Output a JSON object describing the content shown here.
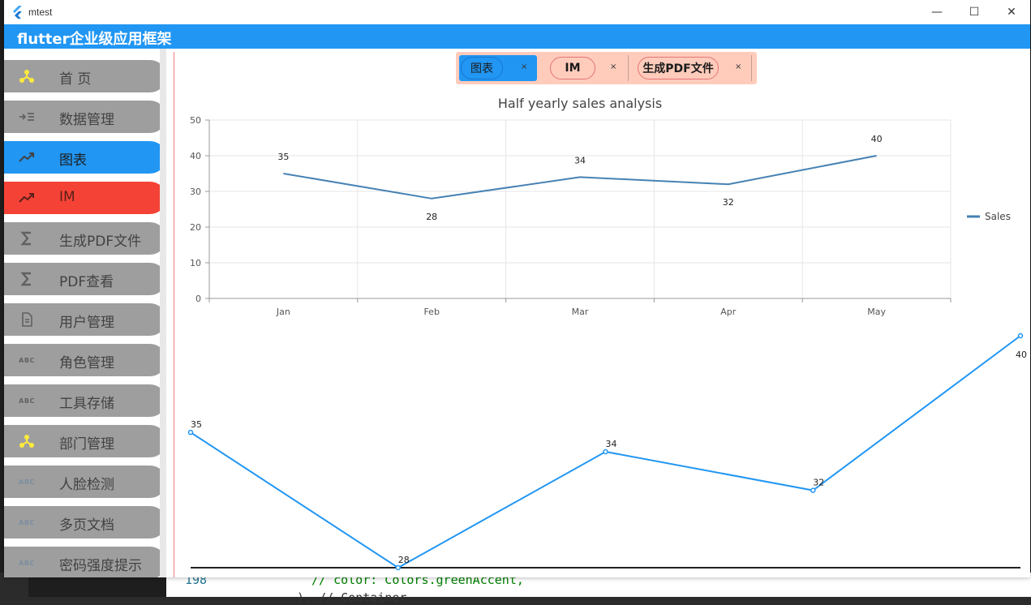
{
  "window": {
    "title": "mtest",
    "minimize": "—",
    "maximize": "☐",
    "close": "✕"
  },
  "appbar": {
    "title": "flutter企业级应用框架"
  },
  "sidebar": {
    "items": [
      {
        "label": "首 页",
        "icon": "hub-icon",
        "color": "#ffeb3b",
        "state": "normal"
      },
      {
        "label": "数据管理",
        "icon": "indent-list-icon",
        "color": "#616161",
        "state": "normal"
      },
      {
        "label": "图表",
        "icon": "trending-up-icon",
        "color": "#424242",
        "state": "active"
      },
      {
        "label": "IM",
        "icon": "trending-up-icon",
        "color": "#5a1f1a",
        "state": "red"
      },
      {
        "label": "生成PDF文件",
        "icon": "sigma-icon",
        "color": "#616161",
        "state": "normal"
      },
      {
        "label": "PDF查看",
        "icon": "sigma-icon",
        "color": "#616161",
        "state": "normal"
      },
      {
        "label": "用户管理",
        "icon": "document-icon",
        "color": "#616161",
        "state": "normal"
      },
      {
        "label": "角色管理",
        "icon": "abc-icon",
        "color": "#616161",
        "state": "normal"
      },
      {
        "label": "工具存储",
        "icon": "abc-icon",
        "color": "#616161",
        "state": "normal"
      },
      {
        "label": "部门管理",
        "icon": "hub-icon",
        "color": "#ffeb3b",
        "state": "normal"
      },
      {
        "label": "人脸检测",
        "icon": "abc-icon",
        "color": "#7b8ea0",
        "state": "normal"
      },
      {
        "label": "多页文档",
        "icon": "abc-icon",
        "color": "#7b8ea0",
        "state": "normal"
      },
      {
        "label": "密码强度提示",
        "icon": "abc-icon",
        "color": "#7b8ea0",
        "state": "normal"
      }
    ],
    "abc_text": "ABC"
  },
  "tabs": [
    {
      "label": "图表",
      "close": "×",
      "active": true
    },
    {
      "label": "IM",
      "close": "×",
      "active": false
    },
    {
      "label": "生成PDF文件",
      "close": "×",
      "active": false
    }
  ],
  "chart_data": [
    {
      "type": "line",
      "title": "Half yearly sales analysis",
      "categories": [
        "Jan",
        "Feb",
        "Mar",
        "Apr",
        "May"
      ],
      "series": [
        {
          "name": "Sales",
          "values": [
            35,
            28,
            34,
            32,
            40
          ],
          "color": "#4682b4"
        }
      ],
      "ylim": [
        0,
        50
      ],
      "yticks": [
        0,
        10,
        20,
        30,
        40,
        50
      ],
      "grid": true,
      "data_labels": true,
      "legend": "right"
    },
    {
      "type": "line",
      "values": [
        35,
        28,
        34,
        32,
        40
      ],
      "color": "#2196f3",
      "markers": true,
      "data_labels": true,
      "axes": false
    }
  ],
  "editor": {
    "line_number": "198",
    "code": "// color: Colors.greenAccent,",
    "code2": "), // Container"
  }
}
